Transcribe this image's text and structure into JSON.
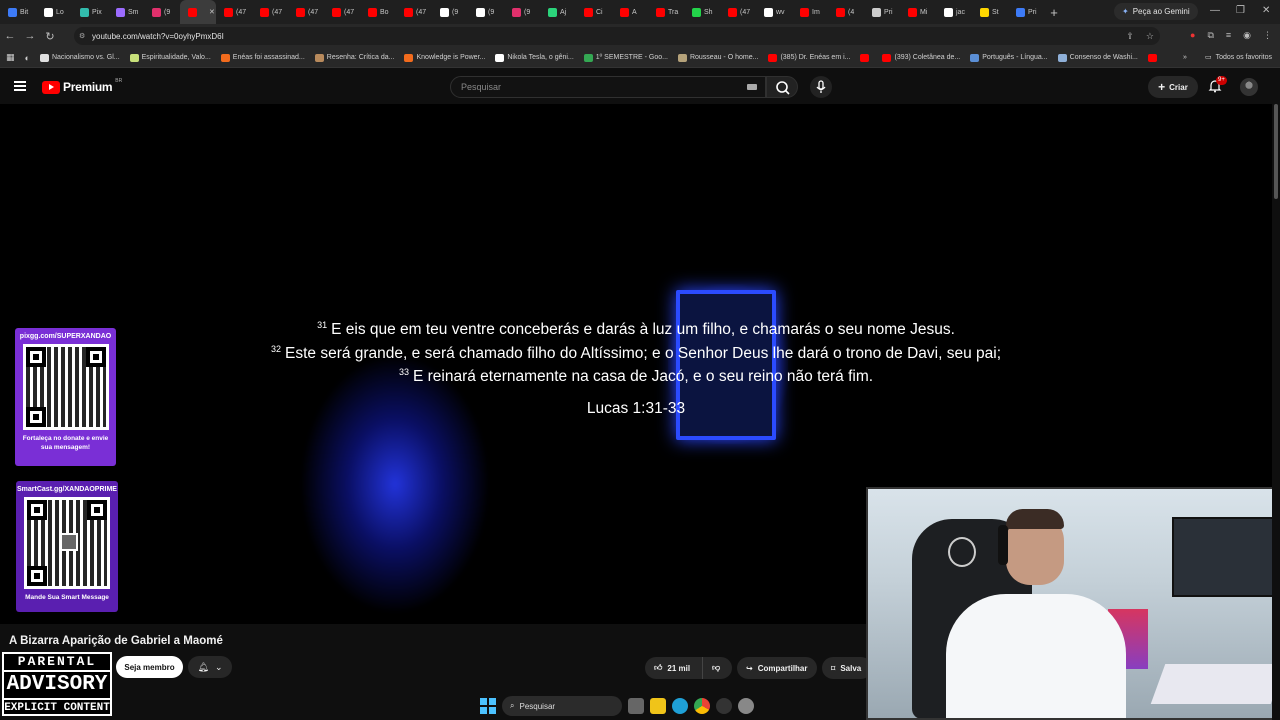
{
  "browser": {
    "tabs": [
      {
        "label": "Bit",
        "color": "#3d7bf7"
      },
      {
        "label": "Lo",
        "color": "#ffffff"
      },
      {
        "label": "Pix",
        "color": "#32bcad"
      },
      {
        "label": "Sm",
        "color": "#9c6cff"
      },
      {
        "label": "(9",
        "color": "#e1306c"
      },
      {
        "label": "",
        "color": "#ff0000",
        "active": true
      },
      {
        "label": "(47",
        "color": "#ff0000"
      },
      {
        "label": "(47",
        "color": "#ff0000"
      },
      {
        "label": "(47",
        "color": "#ff0000"
      },
      {
        "label": "(47",
        "color": "#ff0000"
      },
      {
        "label": "Bo",
        "color": "#ff0000"
      },
      {
        "label": "(47",
        "color": "#ff0000"
      },
      {
        "label": "(9",
        "color": "#ffffff"
      },
      {
        "label": "(9",
        "color": "#ffffff"
      },
      {
        "label": "(9",
        "color": "#e1306c"
      },
      {
        "label": "Aj",
        "color": "#2bd47b"
      },
      {
        "label": "Ci",
        "color": "#ff0000"
      },
      {
        "label": "A",
        "color": "#ff0000"
      },
      {
        "label": "Tra",
        "color": "#ff0000"
      },
      {
        "label": "Sh",
        "color": "#23d44a"
      },
      {
        "label": "(47",
        "color": "#ff0000"
      },
      {
        "label": "wv",
        "color": "#ffffff"
      },
      {
        "label": "Im",
        "color": "#ff0000"
      },
      {
        "label": "(4",
        "color": "#ff0000"
      },
      {
        "label": "Pri",
        "color": "#cccccc"
      },
      {
        "label": "Mi",
        "color": "#ff0000"
      },
      {
        "label": "jac",
        "color": "#ffffff"
      },
      {
        "label": "St",
        "color": "#ffd700"
      },
      {
        "label": "Pri",
        "color": "#3d7bf7"
      }
    ],
    "new_tab": "+",
    "gemini_label": "Peça ao Gemini",
    "url": "youtube.com/watch?v=0oyhyPmxD6I",
    "bookmarks": [
      {
        "label": "Nacionalismo vs. Gl...",
        "color": "#e0e0e0"
      },
      {
        "label": "Espiritualidade, Valo...",
        "color": "#c8e07a"
      },
      {
        "label": "Enéas foi assassinad...",
        "color": "#f26b1d"
      },
      {
        "label": "Resenha: Crítica da...",
        "color": "#b88a5c"
      },
      {
        "label": "Knowledge is Power...",
        "color": "#f26b1d"
      },
      {
        "label": "Nikola Tesla, o gêni...",
        "color": "#ffffff"
      },
      {
        "label": "1º SEMESTRE - Goo...",
        "color": "#34a853"
      },
      {
        "label": "Rousseau - O home...",
        "color": "#b5a27a"
      },
      {
        "label": "(385) Dr. Enéas em i...",
        "color": "#ff0000"
      },
      {
        "label": "",
        "color": "#ff0000"
      },
      {
        "label": "(393) Coletânea de...",
        "color": "#ff0000"
      },
      {
        "label": "Português - Língua...",
        "color": "#5b8fd6"
      },
      {
        "label": "Consenso de Washi...",
        "color": "#8fb0d8"
      },
      {
        "label": "",
        "color": "#ff0000"
      }
    ],
    "bookmarks_more": "»",
    "all_favorites": "Todos os favoritos"
  },
  "youtube": {
    "logo_text": "Premium",
    "country_code": "BR",
    "search_placeholder": "Pesquisar",
    "create_label": "Criar",
    "notifications_badge": "9+"
  },
  "video": {
    "verses": [
      {
        "num": "31",
        "text": "E eis que em teu ventre conceberás e darás à luz um filho, e chamarás o seu nome Jesus."
      },
      {
        "num": "32",
        "text": "Este será grande, e será chamado filho do Altíssimo; e o Senhor Deus lhe dará o trono de Davi, seu pai;"
      },
      {
        "num": "33",
        "text": "E reinará eternamente na casa de Jacó, e o seu reino não terá fim."
      }
    ],
    "reference": "Lucas 1:31-33",
    "qr1": {
      "url": "pixgg.com/SUPERXANDAO",
      "caption": "Fortaleça no donate e envie sua mensagem!"
    },
    "qr2": {
      "url": "SmartCast.gg/XANDAOPRIME",
      "caption": "Mande Sua Smart Message"
    }
  },
  "meta": {
    "title": "A Bizarra Aparição de Gabriel a Maomé",
    "member_label": "Seja membro",
    "likes": "21 mil",
    "share_label": "Compartilhar",
    "save_label": "Salva"
  },
  "advisory": {
    "line1": "PARENTAL",
    "line2": "ADVISORY",
    "line3": "EXPLICIT CONTENT"
  },
  "taskbar": {
    "search_placeholder": "Pesquisar"
  }
}
